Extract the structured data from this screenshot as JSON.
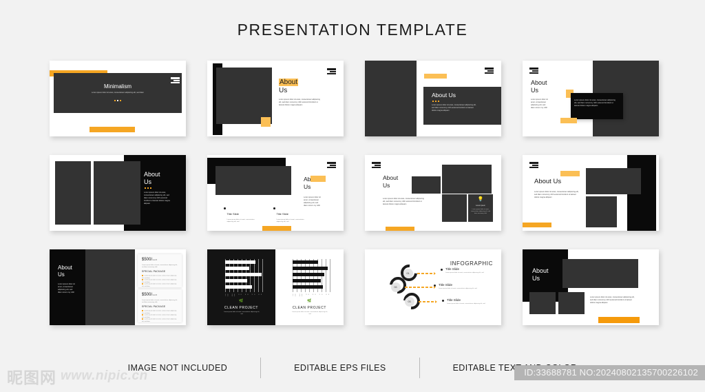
{
  "header": {
    "title": "PRESENTATION TEMPLATE"
  },
  "common": {
    "lorem_short": "Lorem ipsum dolor sit amet, consectetuer adipiscing elit, sed diam",
    "lorem_med": "Lorem ipsum dolor sit amet, consectetuer adipiscing elit, sed diam nonummy nibh euismod tincidunt ut laoreet dolore magna aliquam",
    "lorem_narrow": "Lorem ipsum dolor sit amet, consectetuer adipiscing elit, sed diam nonummy nibh",
    "lorem_tiny": "Lorem ipsum dolor sit amet, consectetuer adipiscing elit, sed",
    "about": "About",
    "us": "Us",
    "about_us": "About Us"
  },
  "slides": [
    {
      "id": "slide-1-minimalism",
      "title": "Minimalism",
      "body": "Lorem ipsum dolor sit amet, consectetuer adipiscing elit, sed diam"
    },
    {
      "id": "slide-2-about-us-highlight",
      "title_a": "About",
      "title_b": "Us",
      "body": "Lorem ipsum dolor sit amet, consectetuer adipiscing elit, sed diam nonummy nibh euismod tincidunt ut laoreet dolore magna aliquam"
    },
    {
      "id": "slide-3-about-us-dark-band",
      "title": "About Us",
      "body": "Lorem ipsum dolor sit amet, consectetuer adipiscing elit, sed diam nonummy nibh euismod tincidunt ut laoreet dolore magna aliquam"
    },
    {
      "id": "slide-4-about-us-split",
      "title_a": "About",
      "title_b": "Us",
      "body_left": "Lorem ipsum dolor sit amet, consectetuer adipiscing elit, sed diam nonum my nibh",
      "body_card": "Lorem ipsum dolor sit amet, consectetuer adipiscing elit, sed diam nonummy nibh euismod tincidunt ut laoreet dolore magna aliquam"
    },
    {
      "id": "slide-5-about-us-two-frames",
      "title_a": "About",
      "title_b": "Us",
      "body": "Lorem ipsum dolor sit amet, consectetuer adipiscing elit, sed diam nonummy nibh euismod tincidunt ut laoreet dolore magna aliquam"
    },
    {
      "id": "slide-6-about-us-bullets",
      "title_a": "About",
      "title_b": "Us",
      "body": "Lorem ipsum dolor sit amet, consectetuer adipiscing elit, sed diam nonum my nibh",
      "bullets": [
        {
          "title": "Title Slide",
          "body": "Lorem ipsum dolor sit amet, consectetuer adipiscing elit, sed"
        },
        {
          "title": "Title Slide",
          "body": "Lorem ipsum dolor sit amet, consectetuer adipiscing elit, sed"
        }
      ]
    },
    {
      "id": "slide-7-about-us-mosaic",
      "title_a": "About",
      "title_b": "Us",
      "body": "Lorem ipsum dolor sit amet, consectetuer adipiscing elit, sed diam nonummy nibh euismod tincidunt ut laoreet dolore magna aliquam",
      "card": {
        "icon": "lightbulb-icon",
        "caption": "Lorem ipsum",
        "body": "Lorem ipsum dolor sit amet, consectetuer adipiscing elit, sed diam nonummy nibh"
      }
    },
    {
      "id": "slide-8-about-us-blocks",
      "title": "About Us",
      "body": "Lorem ipsum dolor sit amet, consectetuer adipiscing elit, sed diam nonummy nibh euismod tincidunt ut laoreet dolore magna aliquam"
    },
    {
      "id": "slide-9-pricing",
      "title_a": "About",
      "title_b": "Us",
      "body": "Lorem ipsum dolor sit amet, consectetuer adipiscing elit, sed diam nonum my nibh",
      "cards": [
        {
          "amount": "$500/",
          "period": "month",
          "sub": "Lorem ipsum dolor sit amet, consectetuer adipiscing elit, sed diam nonummy nibh",
          "heading": "SPECIAL PACKAGE",
          "items": [
            "Lorem ipsum dolor sit amet, consec tetuer adipiscing elit, sed diam",
            "Lorem ipsum dolor sit amet, consec tetuer adipiscing elit, sed diam",
            "Lorem ipsum dolor sit amet, consec tetuer adipiscing elit, sed diam"
          ]
        },
        {
          "amount": "$500/",
          "period": "month",
          "sub": "Lorem ipsum dolor sit amet, consectetuer adipiscing elit, sed diam nonummy nibh",
          "heading": "SPECIAL PACKAGE",
          "items": [
            "Lorem ipsum dolor sit amet, consec tetuer adipiscing elit, sed diam",
            "Lorem ipsum dolor sit amet, consec tetuer adipiscing elit, sed diam",
            "Lorem ipsum dolor sit amet, consec tetuer adipiscing elit, sed diam"
          ]
        }
      ]
    },
    {
      "id": "slide-10-clean-project",
      "panels": [
        {
          "theme": "dark",
          "title": "CLEAN PROJECT",
          "body": "Lorem ipsum dolor sit amet, consectetuer adipiscing elit, sed"
        },
        {
          "theme": "light",
          "title": "CLEAN PROJECT",
          "body": "Lorem ipsum dolor sit amet, consectetuer adipiscing elit, sed"
        }
      ]
    },
    {
      "id": "slide-11-infographic",
      "title": "INFOGRAPHIC",
      "steps": [
        {
          "number": "01.",
          "title": "Title Slide",
          "body": "Lorem ipsum dolor sit amet, consectetuer adipiscing elit, sed"
        },
        {
          "number": "02.",
          "title": "Title Slide",
          "body": "Lorem ipsum dolor sit amet, consectetuer adipiscing elit, sed"
        },
        {
          "number": "03.",
          "title": "Title Slide",
          "body": "Lorem ipsum dolor sit amet, consectetuer adipiscing elit, sed"
        }
      ]
    },
    {
      "id": "slide-12-about-us-gallery",
      "title_a": "About",
      "title_b": "Us",
      "body": "Lorem ipsum dolor sit amet, consectetuer adipiscing elit, sed diam nonummy nibh euismod tincidunt ut laoreet dolore magna aliquam"
    }
  ],
  "chart_data": [
    {
      "type": "bar",
      "orientation": "horizontal",
      "title": "CLEAN PROJECT",
      "theme": "dark",
      "categories": [
        "1",
        "2",
        "3",
        "4",
        "5"
      ],
      "values": [
        78,
        62,
        95,
        58,
        70
      ],
      "xlabel": "",
      "ylabel": "",
      "xlim": [
        0,
        100
      ],
      "grid": true,
      "legend": false,
      "tick_labels": [
        "10",
        "20",
        "30",
        "40",
        "50",
        "60",
        "70",
        "80",
        "90",
        "100"
      ]
    },
    {
      "type": "bar",
      "orientation": "horizontal",
      "title": "CLEAN PROJECT",
      "theme": "light",
      "categories": [
        "1",
        "2",
        "3",
        "4",
        "5"
      ],
      "values": [
        66,
        90,
        82,
        74,
        78
      ],
      "xlabel": "",
      "ylabel": "",
      "xlim": [
        0,
        100
      ],
      "grid": true,
      "legend": false,
      "tick_labels": [
        "10",
        "20",
        "30",
        "40",
        "50",
        "60",
        "70",
        "80",
        "90",
        "100"
      ]
    }
  ],
  "footer": {
    "items": [
      "IMAGE NOT INCLUDED",
      "EDITABLE EPS FILES",
      "EDITABLE TEXT AND COLOR"
    ]
  },
  "watermark": {
    "logo_cn": "昵图网",
    "url": "www.nipic.cn"
  },
  "id_bar": {
    "text": "ID:33688781 NO:20240802135700226102"
  },
  "colors": {
    "accent": "#f5a623",
    "amber": "#fbbf55",
    "dark": "#333333",
    "black": "#0a0a0a",
    "bg": "#f2f2f2"
  }
}
